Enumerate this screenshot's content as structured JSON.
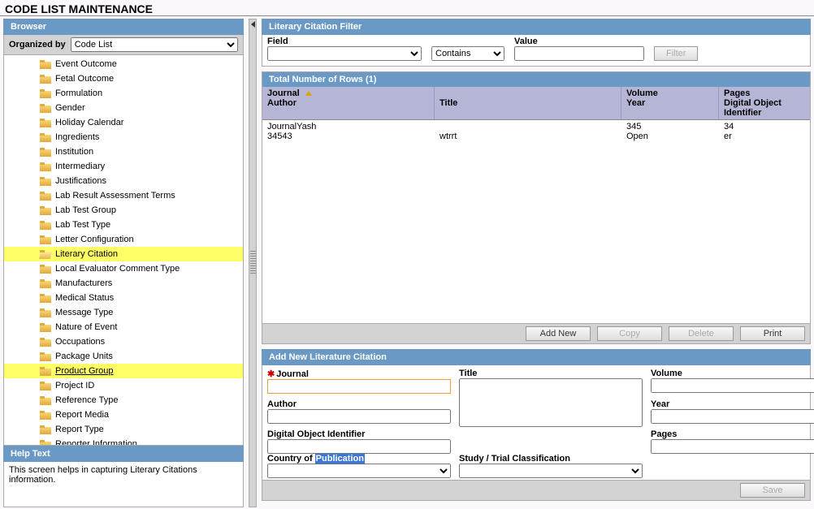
{
  "page_title": "CODE LIST MAINTENANCE",
  "browser": {
    "title": "Browser",
    "organized_by_label": "Organized by",
    "organized_by_value": "Code List",
    "items": [
      {
        "label": "Event Outcome"
      },
      {
        "label": "Fetal Outcome"
      },
      {
        "label": "Formulation"
      },
      {
        "label": "Gender"
      },
      {
        "label": "Holiday Calendar"
      },
      {
        "label": "Ingredients"
      },
      {
        "label": "Institution"
      },
      {
        "label": "Intermediary"
      },
      {
        "label": "Justifications"
      },
      {
        "label": "Lab Result Assessment Terms"
      },
      {
        "label": "Lab Test Group"
      },
      {
        "label": "Lab Test Type"
      },
      {
        "label": "Letter Configuration"
      },
      {
        "label": "Literary Citation",
        "selected": true
      },
      {
        "label": "Local Evaluator Comment Type"
      },
      {
        "label": "Manufacturers"
      },
      {
        "label": "Medical Status"
      },
      {
        "label": "Message Type"
      },
      {
        "label": "Nature of Event"
      },
      {
        "label": "Occupations"
      },
      {
        "label": "Package Units"
      },
      {
        "label": "Product Group",
        "hover": true
      },
      {
        "label": "Project ID"
      },
      {
        "label": "Reference Type"
      },
      {
        "label": "Report Media"
      },
      {
        "label": "Report Type"
      },
      {
        "label": "Reporter Information"
      }
    ]
  },
  "help": {
    "title": "Help Text",
    "body": "This screen helps in capturing Literary Citations information."
  },
  "filter": {
    "title": "Literary Citation Filter",
    "field_label": "Field",
    "operator_value": "Contains",
    "value_label": "Value",
    "filter_btn": "Filter"
  },
  "grid": {
    "title": "Total Number of Rows (1)",
    "headers": {
      "journal": "Journal",
      "author": "Author",
      "title": "Title",
      "volume": "Volume",
      "year": "Year",
      "pages": "Pages",
      "doi": "Digital Object Identifier"
    },
    "rows": [
      {
        "journal": "JournalYash",
        "author": "34543",
        "title": "wtrrt",
        "volume": "345",
        "year": "Open",
        "pages": "34",
        "doi": "er"
      }
    ],
    "add_new": "Add New",
    "copy": "Copy",
    "delete": "Delete",
    "print": "Print"
  },
  "form": {
    "title": "Add New Literature Citation",
    "journal": "Journal",
    "titlelbl": "Title",
    "volume": "Volume",
    "author": "Author",
    "year": "Year",
    "doi": "Digital Object Identifier",
    "pages": "Pages",
    "country": "Country of ",
    "country_hl": "Publication",
    "study": "Study / Trial Classification",
    "save": "Save"
  }
}
